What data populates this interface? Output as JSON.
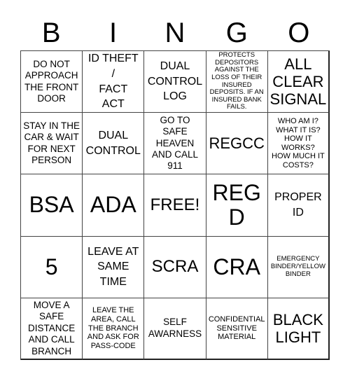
{
  "header": {
    "letters": [
      "B",
      "I",
      "N",
      "G",
      "O"
    ]
  },
  "board": {
    "cells": [
      "DO NOT\nAPPROACH\nTHE FRONT\nDOOR",
      "ID THEFT\n/\nFACT\nACT",
      "DUAL\nCONTROL\nLOG",
      "PROTECTS\nDEPOSITORS\nAGAINST THE\nLOSS OF THEIR\nINSURED\nDEPOSITS. IF AN\nINSURED BANK\nFAILS.",
      "ALL\nCLEAR\nSIGNAL",
      "STAY IN THE\nCAR & WAIT\nFOR NEXT\nPERSON",
      "DUAL\nCONTROL",
      "GO TO\nSAFE\nHEAVEN\nAND CALL\n911",
      "REGCC",
      "WHO AM I?\nWHAT IT IS?\nHOW IT\nWORKS?\nHOW MUCH IT\nCOSTS?",
      "BSA",
      "ADA",
      "FREE!",
      "REG\nD",
      "PROPER\nID",
      "5",
      "LEAVE AT\nSAME\nTIME",
      "SCRA",
      "CRA",
      "EMERGENCY\nBINDER/YELLOW\nBINDER",
      "MOVE A\nSAFE\nDISTANCE\nAND CALL\nBRANCH",
      "LEAVE THE\nAREA, CALL\nTHE BRANCH\nAND ASK FOR\nPASS-CODE",
      "SELF\nAWARNESS",
      "CONFIDENTIAL\nSENSITIVE\nMATERIAL",
      "BLACK\nLIGHT"
    ],
    "free_space_label": "FREE!"
  }
}
